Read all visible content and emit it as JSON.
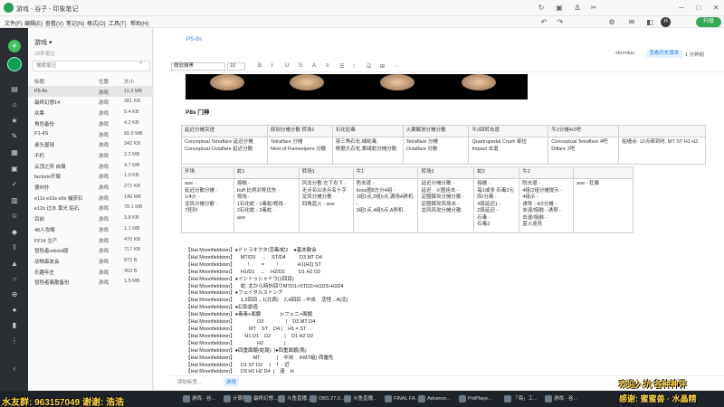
{
  "window": {
    "title": "游戏 - 谷子 - 印象笔记",
    "controls": [
      "↻",
      "▣",
      "Δ",
      "✂",
      "─",
      "□",
      "✕"
    ]
  },
  "menu": [
    "文件(F)",
    "编辑(E)",
    "查看(V)",
    "笔记(N)",
    "格式(O)",
    "工具(T)",
    "帮助(H)"
  ],
  "top_actions": [
    "↶",
    "↷",
    "⚙",
    "✉",
    "◧"
  ],
  "user": {
    "avatar_letter": "H",
    "upgrade_label": "升级"
  },
  "notebook": {
    "name": "游戏",
    "count": "18条笔记",
    "search_placeholder": "搜索笔记",
    "columns": [
      "标题",
      "位置",
      "大小"
    ],
    "notes": [
      [
        "P5-8s",
        "游戏",
        "11.3 MB"
      ],
      [
        "最终幻想14",
        "游戏",
        "381 KB"
      ],
      [
        "众筹",
        "游戏",
        "5.4 KB"
      ],
      [
        "角色备份",
        "游戏",
        "4.2 KB"
      ],
      [
        "P1-4S",
        "游戏",
        "65.9 MB"
      ],
      [
        "桌头屋球",
        "游戏",
        "342 KB"
      ],
      [
        "不朽",
        "游戏",
        "2.2 MB"
      ],
      [
        "云顶之弈 自爆",
        "游戏",
        "4.7 MB"
      ],
      [
        "factorio开服",
        "游戏",
        "1.0 KB"
      ],
      [
        "德州扑",
        "游戏",
        "272 KB"
      ],
      [
        "e11s e10s e9s 捕获石",
        "游戏",
        "146 MB"
      ],
      [
        "e12s 过水 黄光 贴石",
        "游戏",
        "78.1 MB"
      ],
      [
        "目前",
        "游戏",
        "3.8 KB"
      ],
      [
        "48人攻略",
        "游戏",
        "1.1 MB"
      ],
      [
        "FF14 生产",
        "游戏",
        "470 KB"
      ],
      [
        "冒险者reboot版",
        "游戏",
        "717 KB"
      ],
      [
        "动物森友会",
        "游戏",
        "872 B"
      ],
      [
        "乐趣年庄",
        "游戏",
        "453 B"
      ],
      [
        "冒险者离散备份",
        "游戏",
        "1.5 MB"
      ]
    ]
  },
  "editor": {
    "title": "P5-8s",
    "owner": "sforndus",
    "share_label": "查看历史版本",
    "people": "1 分钟前",
    "font": "微软雅黑",
    "size": "10",
    "format_icons": [
      "B",
      "I",
      "U",
      "S",
      "A",
      "≡",
      "☰",
      "⁝",
      "☑",
      "⊞",
      "⋯"
    ],
    "heading": "P8s 门神",
    "table1": {
      "headers": [
        "延迟分摊突进",
        "即刻分摊分散 转场1",
        "石化拉毒",
        "火翼解放分摊分散",
        "牛2回转击退",
        "牛2分摊4/2吧",
        ""
      ],
      "cells": [
        "Conceptual Tetraflare 延迟分摊\nConceptual Octaflare 延迟分散",
        "Tetraflare    分摊\nNest of Flamevipers  分散",
        "穿三角石化,绿蛇毒,\n根据大石化,紫绿蛇分摊分散",
        "Tetraflare    分摊\nOctaflare    分散",
        "Quadrupedal Crush    牵拉\nImpact               击退",
        "Conceptual Tetraflare 4吧\nDiflare               2吧",
        "贴墙点: 12点牵到时, MT ST H1 H2"
      ]
    },
    "table2": {
      "headers": [
        "开场",
        "蛇1",
        "转场1",
        "牛1",
        "转场2",
        "蛇2",
        "牛2",
        ""
      ],
      "cells": [
        "aoe -\n延迟分散分摊 -\n1/4火 -\n龙风分摊分散 -\n7死刑",
        "熔融 -\nbuff 比例对称优先 -\n视线 -\n1石化蛇 - 1毒蛇/视线 -\n2石化蛇 - 2毒蛇 -\naoe",
        "风龙分散 左下右下 -\n无点名X/冰点名十字\n龙风分摊分散 -\n四角蓝火 - aoe",
        "防击退 -\nboss圈8方分4组 -\n1组1点,2组5点,满场A移机 -\n3组1点,4组5点,A移机",
        "延迟分摊分散 -\n延迟 - 火圈连击 -\n定圈棘攻分摊分散 -\n定圈棘攻风场击 -\n龙风风攻分摊分散",
        "熔融 -\n每1或多 石毒2元\n四/分离 -\n4段延迟1 -\n2段延迟 -\n石毒 -\n石毒2",
        "防击退 -\n4组/2组分摊提示 -\n4组示 -\n诱导 - 4/2分摊 -\n击退/熔融 - 诱导 -\n击退/熔融 -\n蓝火连死",
        "aoe - 狂暴"
      ]
    },
    "script": [
      "【Hal Moonfieldxion】●ドトラオクタ/活毒/蛇2    ●基本散会",
      "【Hal Moonfieldxion】    MT/D3    →    ST/D4          D3 MT D4",
      "【Hal Moonfieldxion】         !         =         !              H1(H2) ST",
      "【Hal Moonfieldxion】    H1/D1    ←    H2/D2          D1 H2 D2",
      "【Hal Moonfieldxion】●イントゥシャドウ(1回目)",
      "【Hal Moonfieldxion】    蛇: 北から時計回りMTD1>STD2>H1D3>H2D4",
      "【Hal Moonfieldxion】●フェイタルストンプ",
      "【Hal Moonfieldxion】    1,3回目→1(北西)    2,4回目→中央    活怪→A(北)",
      "【Hal Moonfieldxion】●幻影創造",
      "【Hal Moonfieldxion】●毒毒+面鏡              |<フェニ>面鏡",
      "【Hal Moonfieldxion】                D3                |    D3 MT D4",
      "【Hal Moonfieldxion】          MT    ST    D4 |    H1 = ST",
      "【Hal Moonfieldxion】       H1 D1    D2          |    D1 H2 D2",
      "【Hal Moonfieldxion】                H2               |",
      "【Hal Moonfieldxion】●四重面鏡(蛇尾)  |●四重面鏡(馬)",
      "【Hal Moonfieldxion】             MT            |    中央    ※MT組) 西優先",
      "【Hal Moonfieldxion】    D1 ST D2     |    T    近",
      "【Hal Moonfieldxion】    D3 H1 H2 D4  |    遠    H"
    ],
    "add_tag": "添加标签...",
    "tag": "游戏"
  },
  "taskbar": {
    "tasks": [
      "游戏 - 谷...",
      "游戏 - 谷...",
      "计算器",
      "最终幻想...",
      "斗鱼直播...",
      "OBS 27.0...",
      "斗鱼直播...",
      "FINAL FA...",
      "Advance...",
      "PotPlaye...",
      "「海」工...",
      "游戏 - 谷..."
    ]
  },
  "stream_overlay": {
    "left": "水友群: 963157049 谢谢: 浩浩",
    "right_top": "欢迎入坑 各种神评",
    "right_bottom": "感谢: 蜜蜜兽 · 水晶精"
  }
}
